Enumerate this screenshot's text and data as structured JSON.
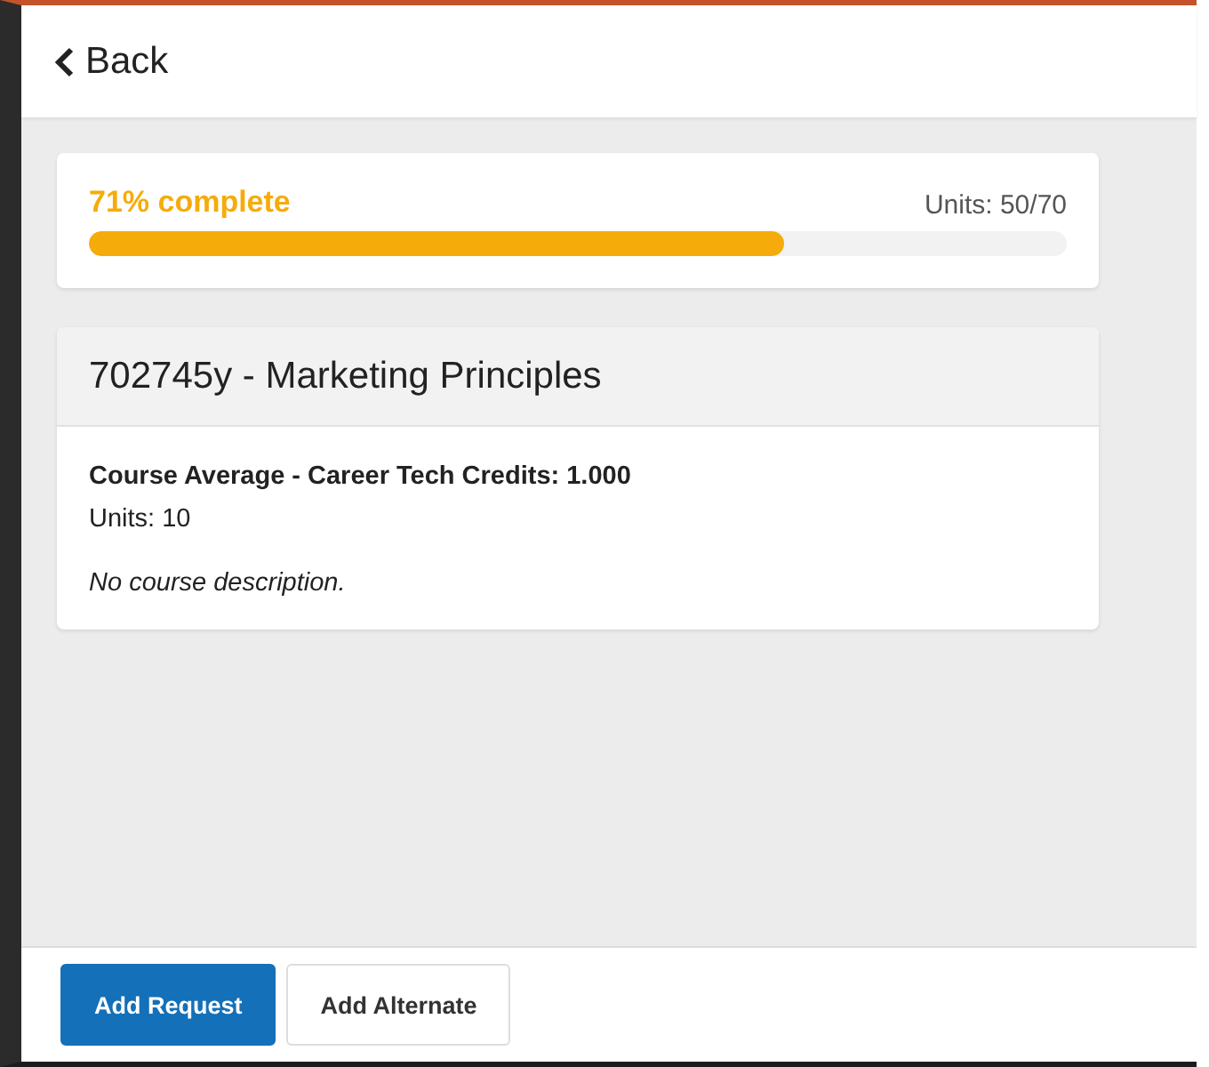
{
  "header": {
    "back_label": "Back"
  },
  "progress": {
    "label": "71% complete",
    "units": "Units: 50/70",
    "level": 0.71
  },
  "course": {
    "title": "702745y - Marketing Principles",
    "credits": "Course Average - Career Tech Credits: 1.000",
    "units": "Units: 10",
    "description": "No course description."
  },
  "buttons": [
    {
      "label": "Add Request",
      "kind": "primary"
    },
    {
      "label": "Add Alternate",
      "kind": "secondary"
    }
  ]
}
